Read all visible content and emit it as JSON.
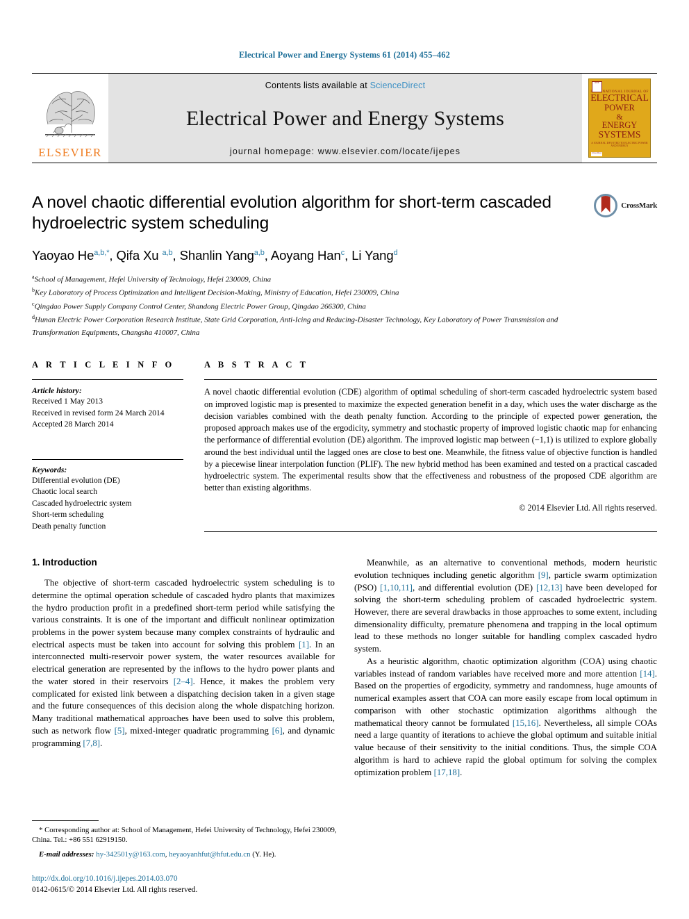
{
  "running_head": "Electrical Power and Energy Systems 61 (2014) 455–462",
  "masthead": {
    "elsevier_wordmark": "ELSEVIER",
    "contents_prefix": "Contents lists available at",
    "sciencedirect": "ScienceDirect",
    "journal_name": "Electrical Power and Energy Systems",
    "homepage": "journal homepage: www.elsevier.com/locate/ijepes",
    "cover": {
      "kicker": "INTERNATIONAL JOURNAL OF",
      "line1": "ELECTRICAL",
      "line2": "POWER",
      "line3": "&",
      "line4": "ENERGY",
      "line5": "SYSTEMS",
      "subtitle": "A JOURNAL DEVOTED TO ELECTRIC POWER AND ENERGY",
      "footer": "ScienceDirect",
      "mark": "IEEE"
    },
    "colors": {
      "cover_background": "#e0a81b",
      "cover_text": "#8a1a12",
      "band_background": "#e3e3e3",
      "elsevier_orange": "#ef7d22",
      "link_blue": "#3a8fc4"
    }
  },
  "article": {
    "title": "A novel chaotic differential evolution algorithm for short-term cascaded hydroelectric system scheduling",
    "crossmark_label": "CrossMark",
    "authors": [
      {
        "name": "Yaoyao He",
        "marks": "a,b,*"
      },
      {
        "name": "Qifa Xu",
        "marks": "a,b"
      },
      {
        "name": "Shanlin Yang",
        "marks": "a,b"
      },
      {
        "name": "Aoyang Han",
        "marks": "c"
      },
      {
        "name": "Li Yang",
        "marks": "d"
      }
    ],
    "affiliations": [
      {
        "mark": "a",
        "text": "School of Management, Hefei University of Technology, Hefei 230009, China"
      },
      {
        "mark": "b",
        "text": "Key Laboratory of Process Optimization and Intelligent Decision-Making, Ministry of Education, Hefei 230009, China"
      },
      {
        "mark": "c",
        "text": "Qingdao Power Supply Company Control Center, Shandong Electric Power Group, Qingdao 266300, China"
      },
      {
        "mark": "d",
        "text": "Hunan Electric Power Corporation Research Institute, State Grid Corporation, Anti-Icing and Reducing-Disaster Technology, Key Laboratory of Power Transmission and Transformation Equipments, Changsha 410007, China"
      }
    ]
  },
  "article_info": {
    "label": "A R T I C L E    I N F O",
    "history_heading": "Article history:",
    "history": [
      "Received 1 May 2013",
      "Received in revised form 24 March 2014",
      "Accepted 28 March 2014"
    ],
    "keywords_heading": "Keywords:",
    "keywords": [
      "Differential evolution (DE)",
      "Chaotic local search",
      "Cascaded hydroelectric system",
      "Short-term scheduling",
      "Death penalty function"
    ]
  },
  "abstract": {
    "label": "A B S T R A C T",
    "text": "A novel chaotic differential evolution (CDE) algorithm of optimal scheduling of short-term cascaded hydroelectric system based on improved logistic map is presented to maximize the expected generation benefit in a day, which uses the water discharge as the decision variables combined with the death penalty function. According to the principle of expected power generation, the proposed approach makes use of the ergodicity, symmetry and stochastic property of improved logistic chaotic map for enhancing the performance of differential evolution (DE) algorithm. The improved logistic map between (−1,1) is utilized to explore globally around the best individual until the lagged ones are close to best one. Meanwhile, the fitness value of objective function is handled by a piecewise linear interpolation function (PLIF). The new hybrid method has been examined and tested on a practical cascaded hydroelectric system. The experimental results show that the effectiveness and robustness of the proposed CDE algorithm are better than existing algorithms.",
    "copyright": "© 2014 Elsevier Ltd. All rights reserved."
  },
  "body": {
    "section_heading": "1. Introduction",
    "left_paragraphs": [
      "The objective of short-term cascaded hydroelectric system scheduling is to determine the optimal operation schedule of cascaded hydro plants that maximizes the hydro production profit in a predefined short-term period while satisfying the various constraints. It is one of the important and difficult nonlinear optimization problems in the power system because many complex constraints of hydraulic and electrical aspects must be taken into account for solving this problem [1]. In an interconnected multi-reservoir power system, the water resources available for electrical generation are represented by the inflows to the hydro power plants and the water stored in their reservoirs [2–4]. Hence, it makes the problem very complicated for existed link between a dispatching decision taken in a given stage and the future consequences of this decision along the whole dispatching horizon. Many traditional mathematical approaches have been used to solve this problem, such as network flow [5], mixed-integer quadratic programming [6], and dynamic programming [7,8]."
    ],
    "right_paragraphs": [
      "Meanwhile, as an alternative to conventional methods, modern heuristic evolution techniques including genetic algorithm [9], particle swarm optimization (PSO) [1,10,11], and differential evolution (DE) [12,13] have been developed for solving the short-term scheduling problem of cascaded hydroelectric system. However, there are several drawbacks in those approaches to some extent, including dimensionality difficulty, premature phenomena and trapping in the local optimum lead to these methods no longer suitable for handling complex cascaded hydro system.",
      "As a heuristic algorithm, chaotic optimization algorithm (COA) using chaotic variables instead of random variables have received more and more attention [14]. Based on the properties of ergodicity, symmetry and randomness, huge amounts of numerical examples assert that COA can more easily escape from local optimum in comparison with other stochastic optimization algorithms although the mathematical theory cannot be formulated [15,16]. Nevertheless, all simple COAs need a large quantity of iterations to achieve the global optimum and suitable initial value because of their sensitivity to the initial conditions. Thus, the simple COA algorithm is hard to achieve rapid the global optimum for solving the complex optimization problem [17,18]."
    ]
  },
  "footnotes": {
    "corresponding_marker": "*",
    "corresponding_text": "Corresponding author at: School of Management, Hefei University of Technology, Hefei 230009, China. Tel.: +86 551 62919150.",
    "email_label": "E-mail addresses:",
    "email_1": "hy-342501y@163.com",
    "email_2": "heyaoyanhfut@hfut.edu.cn",
    "email_suffix": "(Y. He).",
    "doi": "http://dx.doi.org/10.1016/j.ijepes.2014.03.070",
    "issn": "0142-0615/© 2014 Elsevier Ltd. All rights reserved."
  }
}
